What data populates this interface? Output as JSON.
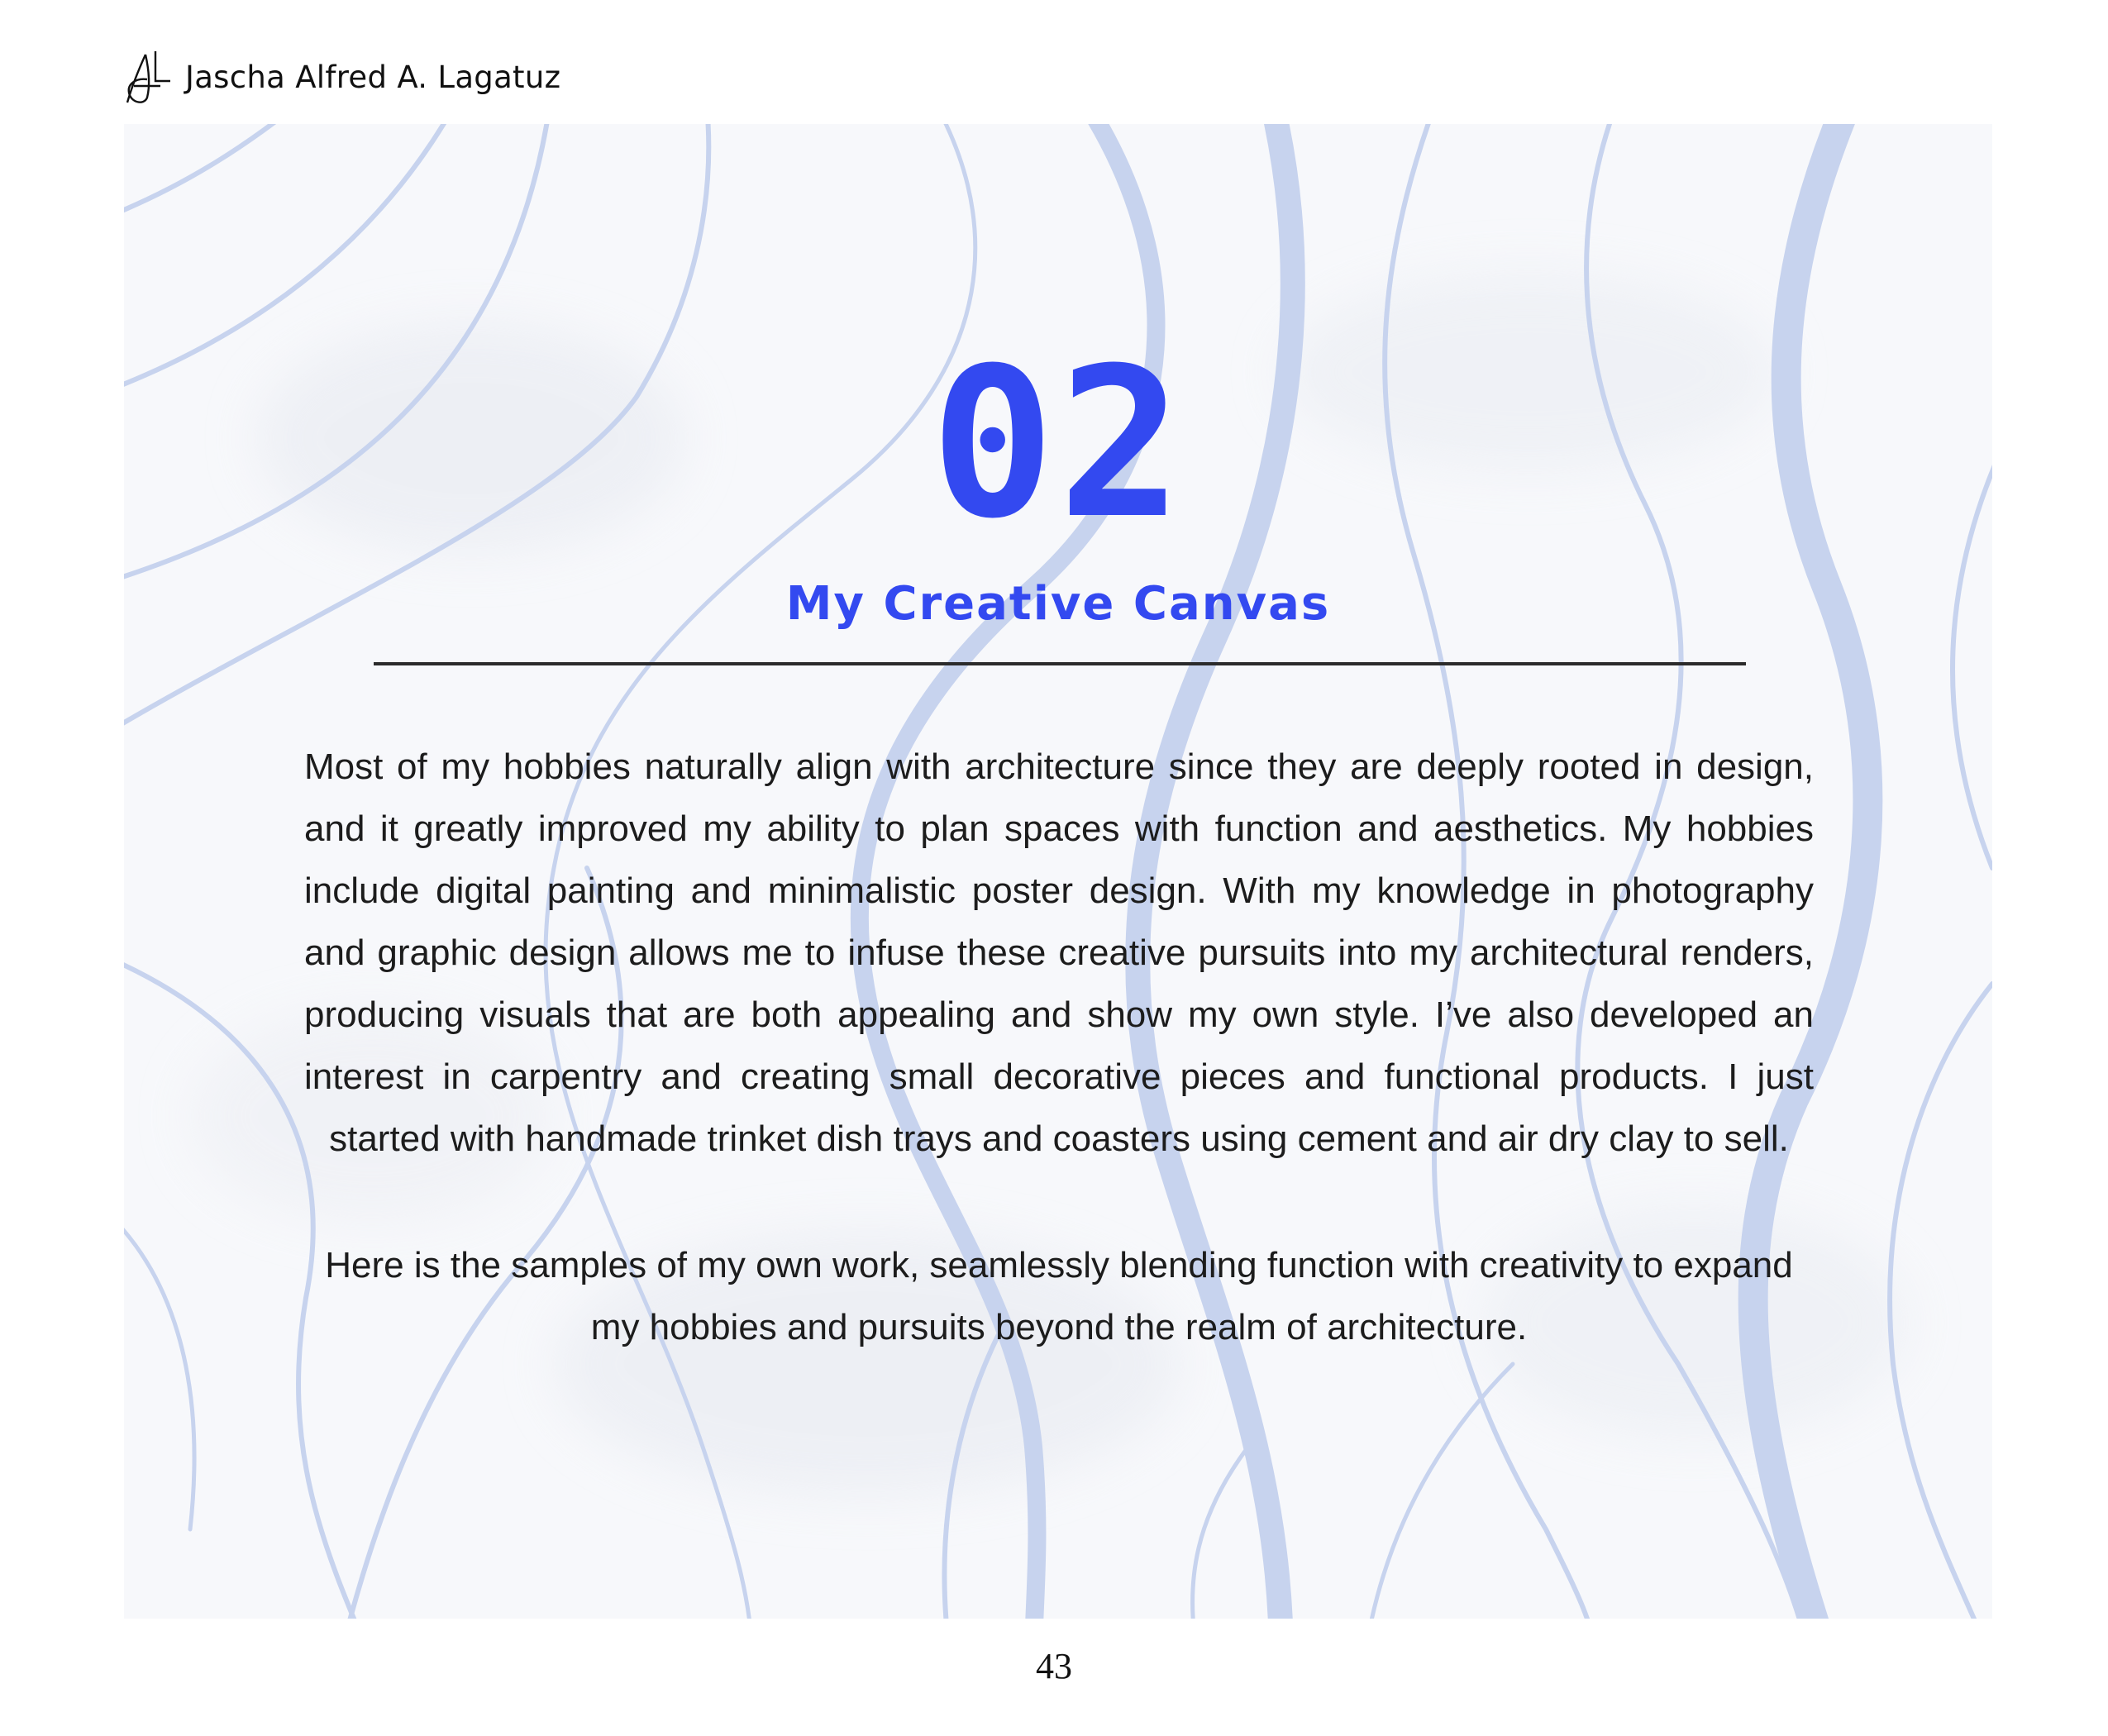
{
  "header": {
    "logo_icon": "al-monogram-logo",
    "author": "Jascha Alfred A. Lagatuz"
  },
  "section": {
    "number": "02",
    "title": "My Creative Canvas"
  },
  "body": {
    "paragraph_1": "Most of my hobbies naturally align with architecture since they are deeply rooted in design, and it greatly improved my ability to plan spaces with function and aesthetics. My hobbies include digital painting and minimalistic poster design. With my knowledge in photography and graphic design allows me to infuse these creative pursuits into my architectural renders, producing visuals that are both appealing and show my own style. I’ve also developed an interest in carpentry and creating  small decorative pieces and functional products. I just started with handmade trinket dish trays and coasters using cement and air dry clay to sell.",
    "paragraph_2": "Here is the samples of my own work, seamlessly blending function with creativity to expand my hobbies and pursuits beyond the realm of architecture."
  },
  "footer": {
    "page_number": "43"
  },
  "colors": {
    "accent": "#3349f0",
    "wave_lines": "#c7d3ee",
    "divider": "#2b2b2b"
  }
}
